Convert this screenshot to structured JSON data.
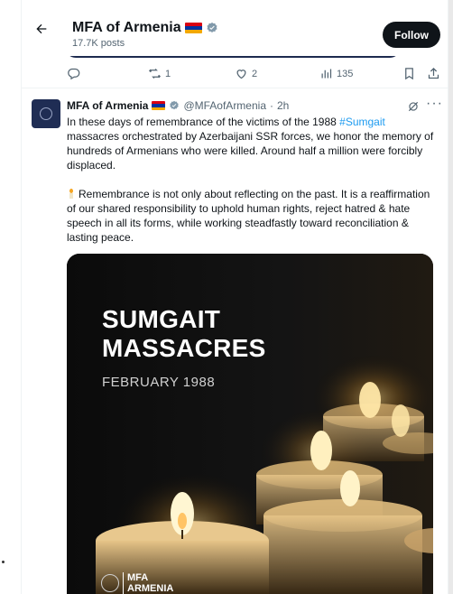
{
  "header": {
    "name": "MFA of Armenia",
    "posts": "17.7K posts",
    "follow_label": "Follow"
  },
  "flag_colors": [
    "#d90012",
    "#0033a0",
    "#f2a800"
  ],
  "actions": {
    "retweets": "1",
    "likes": "2",
    "views": "135"
  },
  "tweet": {
    "name": "MFA of Armenia",
    "handle": "@MFAofArmenia",
    "separator": "·",
    "time": "2h",
    "p1_before": "In these days of remembrance of the victims of the 1988 ",
    "hashtag": "#Sumgait",
    "p1_after": " massacres orchestrated by Azerbaijani SSR forces, we honor the memory of hundreds of Armenians who were killed. Around half a million were forcibly displaced.",
    "p2": "Remembrance is not only about reflecting on the past. It is a reaffirmation of our shared responsibility to uphold human rights, reject hatred & hate speech in all its forms, while working steadfastly toward reconciliation & lasting peace."
  },
  "media": {
    "title_line1": "SUMGAIT",
    "title_line2": "MASSACRES",
    "date": "FEBRUARY 1988",
    "logo_line1": "MFA",
    "logo_line2": "ARMENIA"
  },
  "icons": {
    "back": "arrow-left-icon",
    "verified": "verified-badge-icon",
    "reply": "reply-icon",
    "retweet": "retweet-icon",
    "like": "heart-icon",
    "views": "views-icon",
    "bookmark": "bookmark-icon",
    "share": "share-icon",
    "grok": "grok-icon",
    "more": "more-icon"
  },
  "accent_color": "#1d9bf0"
}
